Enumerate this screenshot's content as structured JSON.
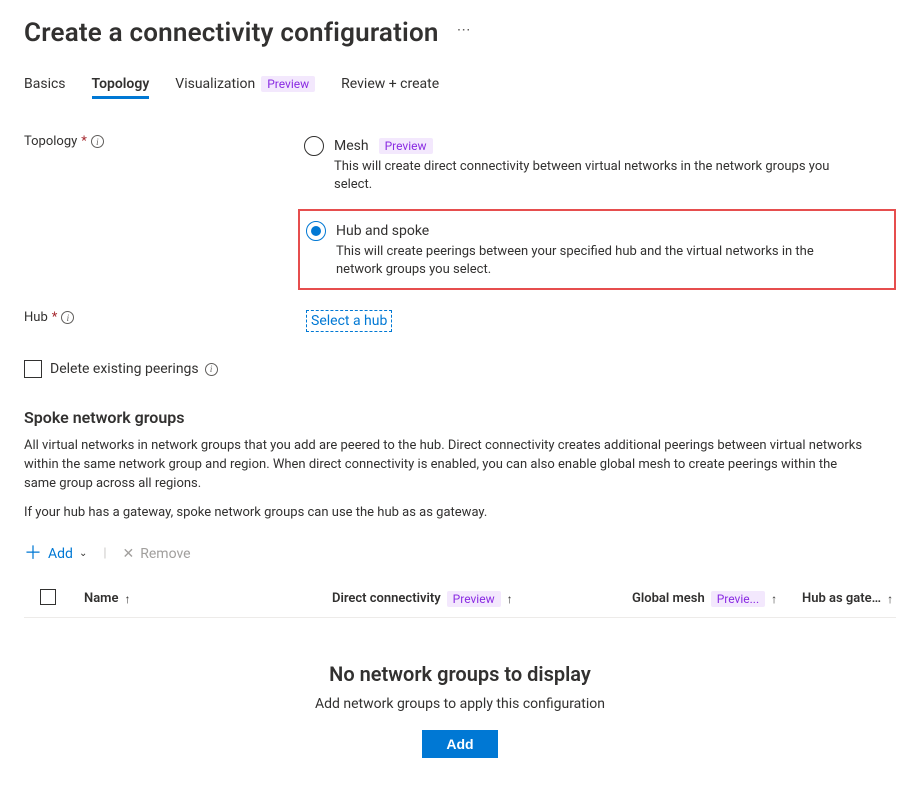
{
  "page": {
    "title": "Create a connectivity configuration"
  },
  "tabs": {
    "basics": "Basics",
    "topology": "Topology",
    "visualization": "Visualization",
    "visualization_badge": "Preview",
    "review": "Review + create"
  },
  "form": {
    "topology_label": "Topology",
    "hub_label": "Hub",
    "mesh": {
      "title": "Mesh",
      "badge": "Preview",
      "desc": "This will create direct connectivity between virtual networks in the network groups you select."
    },
    "hubspoke": {
      "title": "Hub and spoke",
      "desc": "This will create peerings between your specified hub and the virtual networks in the network groups you select."
    },
    "select_hub_link": "Select a hub",
    "delete_peerings_label": "Delete existing peerings"
  },
  "spoke": {
    "title": "Spoke network groups",
    "desc1": "All virtual networks in network groups that you add are peered to the hub. Direct connectivity creates additional peerings between virtual networks within the same network group and region. When direct connectivity is enabled, you can also enable global mesh to create peerings within the same group across all regions.",
    "desc2": "If your hub has a gateway, spoke network groups can use the hub as as gateway."
  },
  "toolbar": {
    "add": "Add",
    "remove": "Remove"
  },
  "table": {
    "name": "Name",
    "dc": "Direct connectivity",
    "dc_badge": "Preview",
    "gm": "Global mesh",
    "gm_badge": "Previe...",
    "hg": "Hub as gate…"
  },
  "empty": {
    "title": "No network groups to display",
    "sub": "Add network groups to apply this configuration",
    "button": "Add"
  }
}
